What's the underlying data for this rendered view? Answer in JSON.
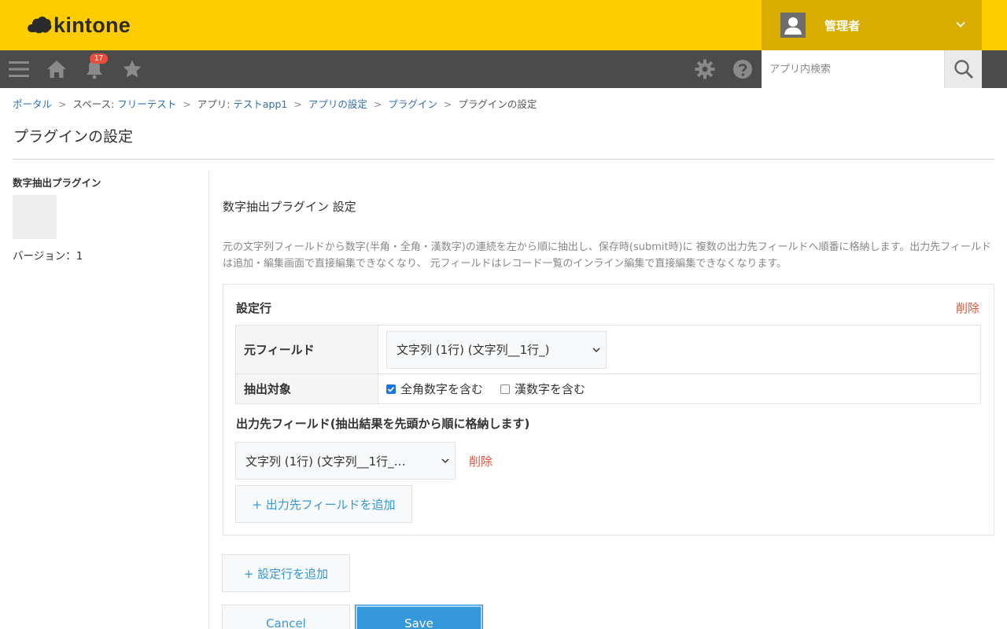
{
  "app": {
    "logo_text": "kintone"
  },
  "header": {
    "user_name": "管理者"
  },
  "navbar": {
    "notification_count": "17",
    "search_placeholder": "アプリ内検索"
  },
  "breadcrumb": {
    "portal": "ポータル",
    "space_prefix": "スペース: ",
    "space_name": "フリーテスト",
    "app_prefix": "アプリ: ",
    "app_name": "テストapp1",
    "app_settings": "アプリの設定",
    "plugins": "プラグイン",
    "current": "プラグインの設定",
    "separator": ">"
  },
  "page": {
    "title": "プラグインの設定"
  },
  "sidebar": {
    "plugin_name": "数字抽出プラグイン",
    "version": "バージョン：1"
  },
  "main": {
    "settings_title": "数字抽出プラグイン 設定",
    "description": "元の文字列フィールドから数字(半角・全角・漢数字)の連続を左から順に抽出し、保存時(submit時)に 複数の出力先フィールドへ順番に格納します。出力先フィールドは追加・編集画面で直接編集できなくなり、 元フィールドはレコード一覧のインライン編集で直接編集できなくなります。",
    "row": {
      "title": "設定行",
      "delete_label": "削除",
      "source_field_label": "元フィールド",
      "source_field_value": "文字列 (1行) (文字列__1行_)",
      "target_label": "抽出対象",
      "options": [
        {
          "label": "全角数字を含む",
          "checked": true
        },
        {
          "label": "漢数字を含む",
          "checked": false
        }
      ],
      "output_title": "出力先フィールド(抽出結果を先頭から順に格納します)",
      "output_value": "文字列 (1行) (文字列__1行_…",
      "output_delete_label": "削除",
      "add_output_label": "+ 出力先フィールドを追加"
    },
    "add_row_label": "+ 設定行を追加",
    "cancel_label": "Cancel",
    "save_label": "Save"
  },
  "colors": {
    "header_bg": "#ffcc00",
    "user_area_bg": "#d9ad00",
    "navbar_bg": "#4b4b4b",
    "link": "#2f6fb3",
    "delete": "#e5533d",
    "primary": "#3498db"
  }
}
